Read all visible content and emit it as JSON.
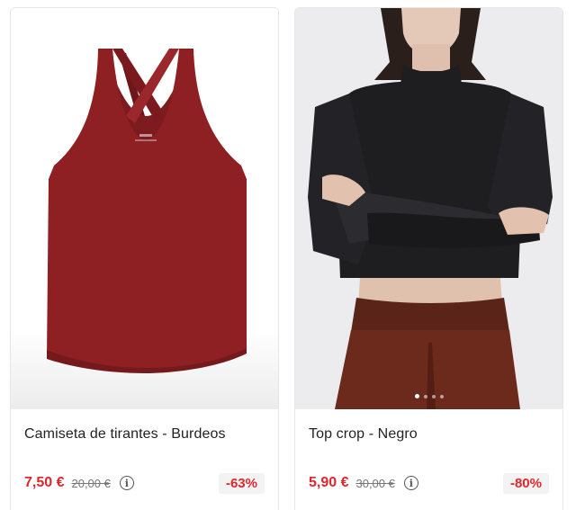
{
  "products": [
    {
      "name": "Camiseta de tirantes - Burdeos",
      "price": "7,50 €",
      "old_price": "20,00 €",
      "discount": "-63%",
      "garment_color": "#8e2024",
      "image_icon": "tank-top-image"
    },
    {
      "name": "Top crop - Negro",
      "price": "5,90 €",
      "old_price": "30,00 €",
      "discount": "-80%",
      "garment_color": "#1e1e21",
      "image_icon": "model-crop-top-image",
      "carousel": {
        "count": 4,
        "active": 1
      }
    }
  ],
  "colors": {
    "price": "#e0262b",
    "badge_bg": "#f3f3f3"
  }
}
